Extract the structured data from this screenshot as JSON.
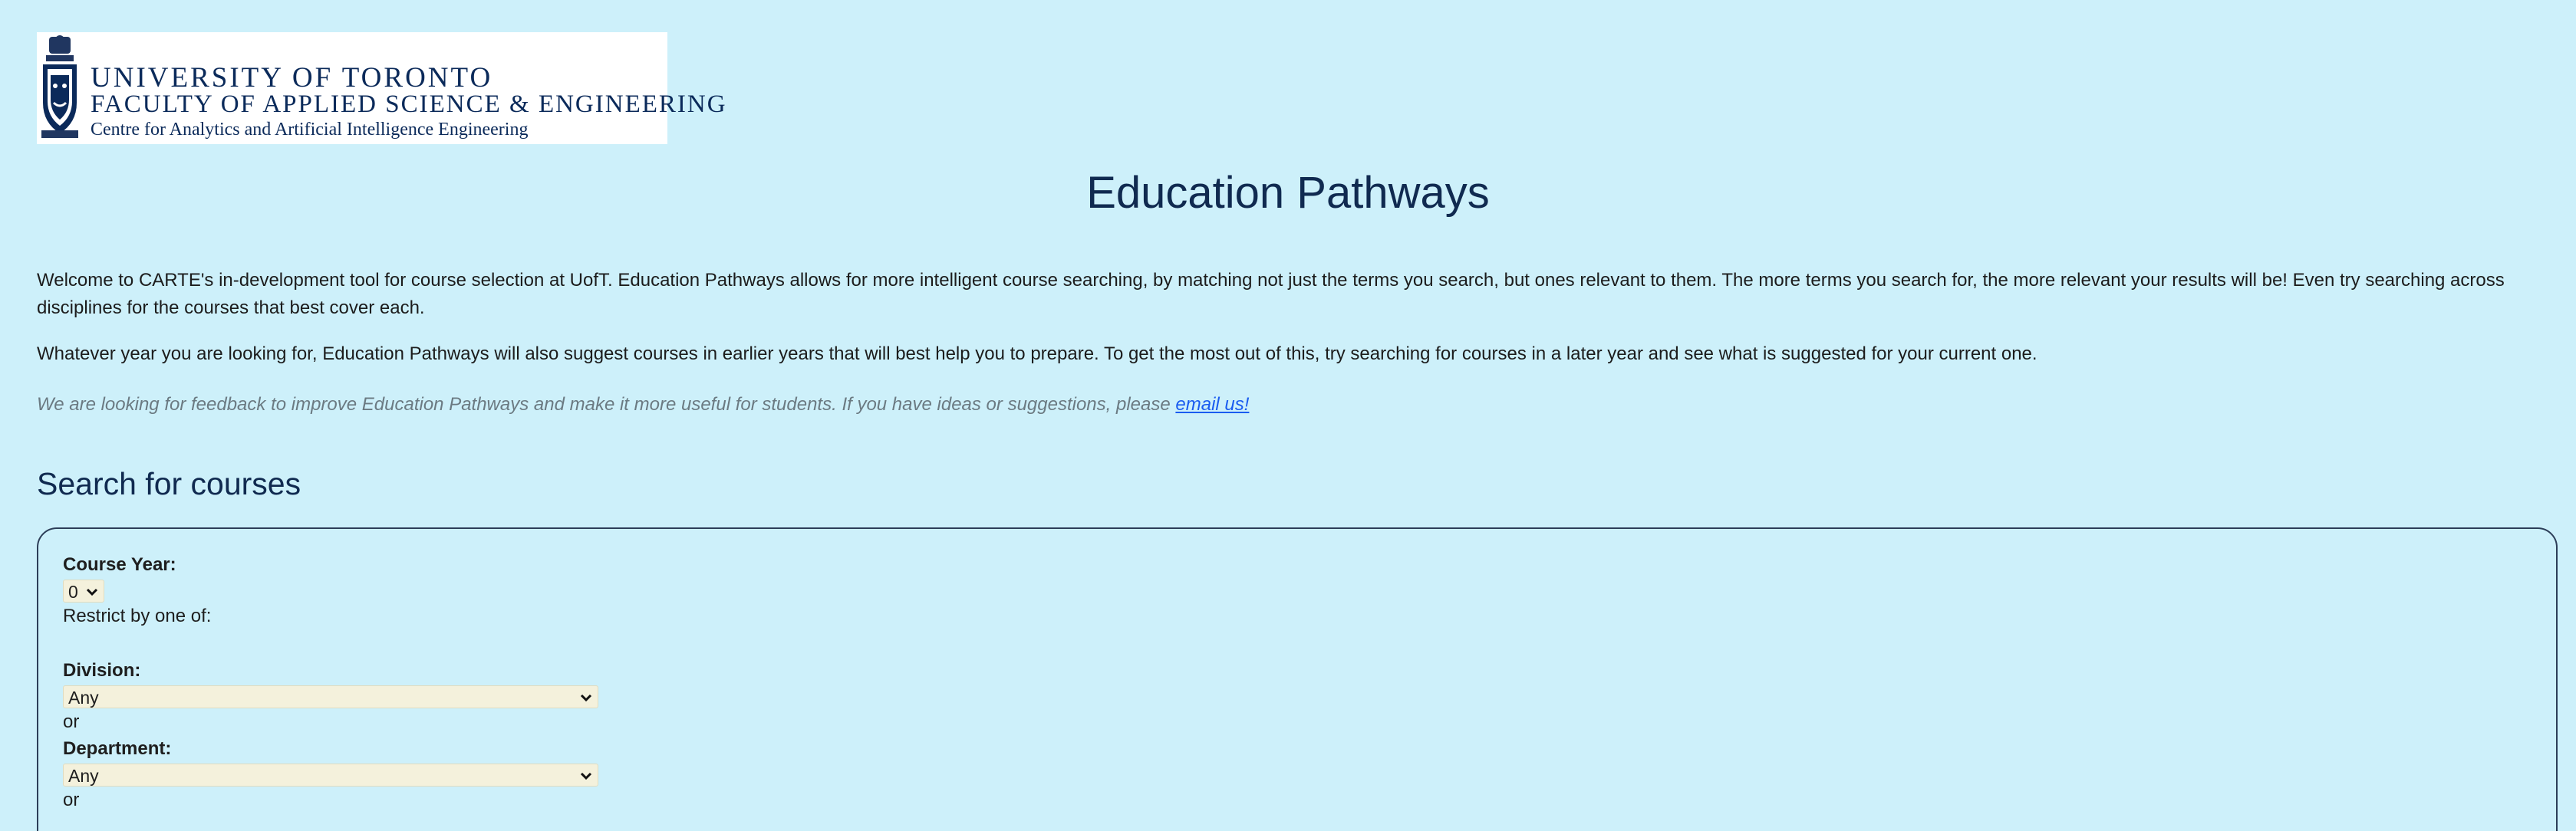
{
  "logo": {
    "line1": "UNIVERSITY OF TORONTO",
    "line2": "FACULTY OF APPLIED SCIENCE & ENGINEERING",
    "line3": "Centre for Analytics and Artificial Intelligence Engineering"
  },
  "page_title": "Education Pathways",
  "intro": {
    "paragraph1": "Welcome to CARTE's in-development tool for course selection at UofT. Education Pathways allows for more intelligent course searching, by matching not just the terms you search, but ones relevant to them. The more terms you search for, the more relevant your results will be! Even try searching across disciplines for the courses that best cover each.",
    "paragraph2": "Whatever year you are looking for, Education Pathways will also suggest courses in earlier years that will best help you to prepare. To get the most out of this, try searching for courses in a later year and see what is suggested for your current one.",
    "feedback_text": "We are looking for feedback to improve Education Pathways and make it more useful for students. If you have ideas or suggestions, please ",
    "feedback_link": "email us!"
  },
  "search": {
    "section_title": "Search for courses",
    "course_year_label": "Course Year:",
    "course_year_value": "0",
    "restrict_text": "Restrict by one of:",
    "division_label": "Division:",
    "division_value": "Any",
    "or_1": "or",
    "department_label": "Department:",
    "department_value": "Any",
    "or_2": "or"
  },
  "colors": {
    "background": "#cdf0fa",
    "title": "#102a50",
    "link": "#1a5cf0",
    "select_bg": "#f4f1dc"
  }
}
